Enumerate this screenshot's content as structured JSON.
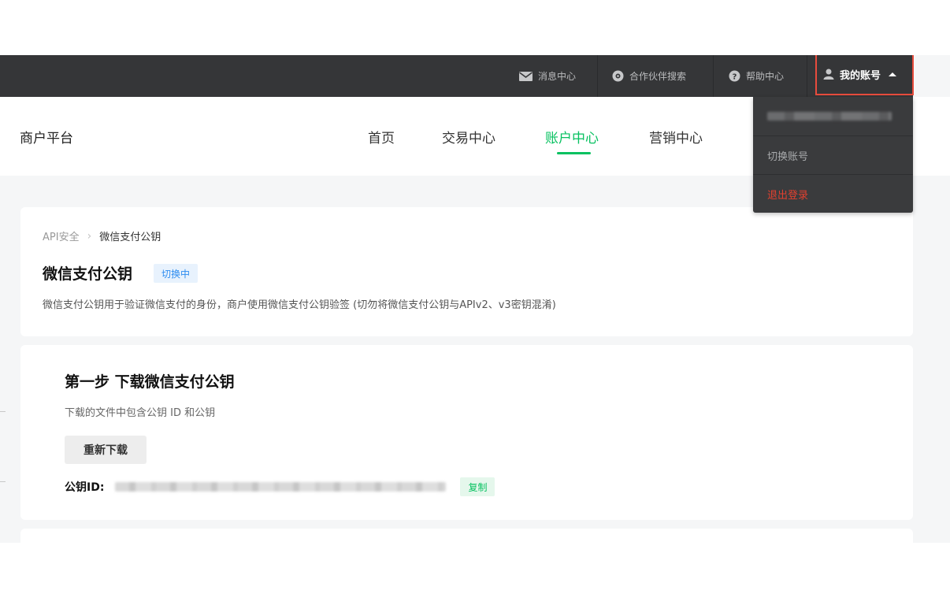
{
  "topbar": {
    "items": [
      {
        "label": "消息中心",
        "icon": "mail-icon"
      },
      {
        "label": "合作伙伴搜索",
        "icon": "partner-search-icon"
      },
      {
        "label": "帮助中心",
        "icon": "help-icon"
      }
    ],
    "account": {
      "label": "我的账号",
      "icon": "user-icon"
    }
  },
  "header": {
    "brand": "商户平台",
    "menu": [
      {
        "label": "首页"
      },
      {
        "label": "交易中心"
      },
      {
        "label": "账户中心",
        "active": true
      },
      {
        "label": "营销中心"
      }
    ]
  },
  "dropdown": {
    "items": [
      {
        "label": "切换账号"
      },
      {
        "label": "退出登录"
      }
    ]
  },
  "breadcrumb": {
    "parent": "API安全",
    "current": "微信支付公钥"
  },
  "intro": {
    "title": "微信支付公钥",
    "badge": "切换中",
    "description": "微信支付公钥用于验证微信支付的身份，商户使用微信支付公钥验签 (切勿将微信支付公钥与APIv2、v3密钥混淆)"
  },
  "step1": {
    "title": "第一步 下载微信支付公钥",
    "description": "下载的文件中包含公钥 ID 和公钥",
    "download_button": "重新下载",
    "key_label": "公钥ID:",
    "copy_button": "复制"
  },
  "colors": {
    "accent_green": "#07c160",
    "badge_blue": "#2d8cf0",
    "highlight_red": "#e84c3d",
    "logout_red": "#e3402f",
    "topbar_bg": "#353638"
  }
}
